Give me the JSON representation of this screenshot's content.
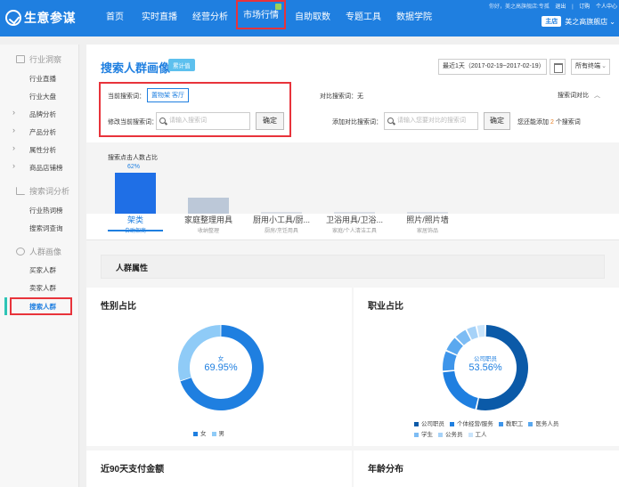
{
  "app": {
    "logo_text": "生意参谋",
    "nav": [
      "首页",
      "实时直播",
      "经营分析",
      "市场行情",
      "自助取数",
      "专题工具",
      "数据学院"
    ],
    "active_nav": "市场行情",
    "top_links": [
      "你好，美之高旗舰店:专孤",
      "退出",
      "订购",
      "个人中心"
    ],
    "shop_badge": "主店",
    "shop_name": "美之高旗舰店"
  },
  "sidebar": {
    "sections": [
      {
        "label": "行业洞察",
        "icon": "monitor-icon"
      },
      {
        "label": "搜索词分析",
        "icon": "bar-chart-icon"
      },
      {
        "label": "人群画像",
        "icon": "people-icon"
      }
    ],
    "industry_items": [
      "行业直播",
      "行业大盘",
      "品牌分析",
      "产品分析",
      "属性分析",
      "商品店铺榜"
    ],
    "search_items": [
      "行业热词榜",
      "搜索词查询"
    ],
    "crowd_items": [
      "买家人群",
      "卖家人群",
      "搜索人群"
    ],
    "current": "搜索人群"
  },
  "header": {
    "title": "搜索人群画像",
    "tag": "累计值",
    "date_range": "最近1天（2017-02-19~2017-02-19）",
    "terminal": "所有终端"
  },
  "query": {
    "current_label": "当前搜索词：",
    "current_term": "置物架 客厅",
    "modify_label": "修改当前搜索词：",
    "modify_placeholder": "请输入搜索词",
    "confirm": "确定",
    "compare_label": "对比搜索词：无",
    "compare_toggle": "搜索词对比",
    "add_compare_label": "添加对比搜索词：",
    "add_compare_placeholder": "请输入您要对比的搜索词",
    "confirm2": "确定",
    "hint_prefix": "您还能添加",
    "hint_count": "2",
    "hint_suffix": "个搜索词"
  },
  "category_chart": {
    "title": "搜索点击人数占比",
    "top_label": "62%",
    "categories": [
      {
        "name": "架类",
        "sub": "自助架商",
        "value": 62,
        "color": "#1f6fe6"
      },
      {
        "name": "家庭整理用具",
        "sub": "收纳整理",
        "value": 24,
        "color": "#bcc8d8"
      },
      {
        "name": "厨用小工具/厨...",
        "sub": "厨房/烹饪用具",
        "value": 3,
        "color": "#d8dde4"
      },
      {
        "name": "卫浴用具/卫浴...",
        "sub": "家庭/个人清洁工具",
        "value": 2,
        "color": "#d8dde4"
      },
      {
        "name": "照片/照片墙",
        "sub": "家居饰品",
        "value": 1,
        "color": "#d8dde4"
      }
    ],
    "active": 0
  },
  "section": {
    "title": "人群属性"
  },
  "gender": {
    "title": "性别占比",
    "center_label": "女",
    "center_value": "69.95%",
    "legend": [
      {
        "name": "女",
        "value": 69.95,
        "color": "#1f7fe0"
      },
      {
        "name": "男",
        "value": 30.05,
        "color": "#8fcbf7"
      }
    ]
  },
  "occupation": {
    "title": "职业占比",
    "center_label": "公司职员",
    "center_value": "53.56%",
    "legend": [
      {
        "name": "公司职员",
        "value": 53.56,
        "color": "#0b5aa8"
      },
      {
        "name": "个体经营/服务",
        "value": 20.0,
        "color": "#1f7fe0"
      },
      {
        "name": "教职工",
        "value": 8.0,
        "color": "#3e95ea"
      },
      {
        "name": "医务人员",
        "value": 6.0,
        "color": "#5aa8ef"
      },
      {
        "name": "学生",
        "value": 5.0,
        "color": "#7dbcf4"
      },
      {
        "name": "公务员",
        "value": 4.0,
        "color": "#a6d2f8"
      },
      {
        "name": "工人",
        "value": 3.44,
        "color": "#c9e4fb"
      }
    ]
  },
  "bottom_cards": {
    "pay": "近90天支付金额",
    "age": "年龄分布"
  }
}
